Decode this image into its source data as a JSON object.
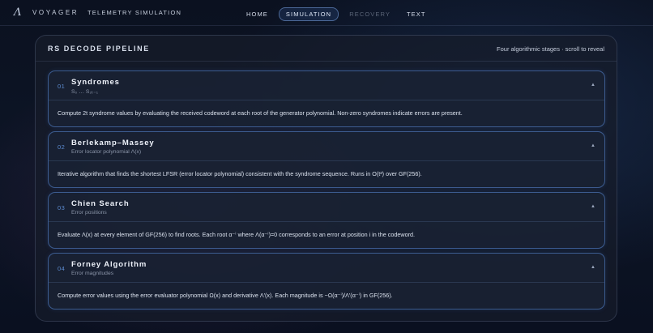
{
  "topbar": {
    "brand": "VOYAGER",
    "section": "TELEMETRY SIMULATION",
    "nav": [
      {
        "label": "HOME",
        "state": "normal"
      },
      {
        "label": "SIMULATION",
        "state": "active"
      },
      {
        "label": "RECOVERY",
        "state": "disabled"
      },
      {
        "label": "TEXT",
        "state": "normal"
      }
    ]
  },
  "panel": {
    "title": "RS DECODE PIPELINE",
    "note": "Four algorithmic stages · scroll to reveal"
  },
  "stages": [
    {
      "num": "01",
      "title": "Syndromes",
      "subtitle": "S₀ … S₂ₜ₋₁",
      "body": "Compute 2t syndrome values by evaluating the received codeword at each root of the generator polynomial. Non-zero syndromes indicate errors are present."
    },
    {
      "num": "02",
      "title": "Berlekamp–Massey",
      "subtitle": "Error locator polynomial Λ(x)",
      "body": "Iterative algorithm that finds the shortest LFSR (error locator polynomial) consistent with the syndrome sequence. Runs in O(t²) over GF(256)."
    },
    {
      "num": "03",
      "title": "Chien Search",
      "subtitle": "Error positions",
      "body": "Evaluate Λ(x) at every element of GF(256) to find roots. Each root α⁻ⁱ where Λ(α⁻ⁱ)=0 corresponds to an error at position i in the codeword."
    },
    {
      "num": "04",
      "title": "Forney Algorithm",
      "subtitle": "Error magnitudes",
      "body": "Compute error values using the error evaluator polynomial Ω(x) and derivative Λ'(x). Each magnitude is −Ω(α⁻ⁱ)/Λ'(α⁻ⁱ) in GF(256)."
    }
  ],
  "icons": {
    "logo": "lambda-logo-icon",
    "chevron": "chevron-up-icon"
  }
}
